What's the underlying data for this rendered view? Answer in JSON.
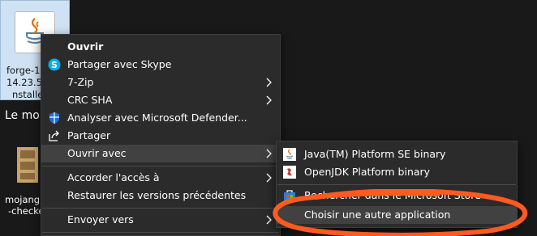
{
  "desktop": {
    "selected_icon_label": [
      "forge-1",
      "14.23.5.",
      "nstalle"
    ],
    "section_label": "Le mo",
    "mojang_label": [
      "mojang",
      "-checke"
    ]
  },
  "context_menu": {
    "items": [
      {
        "label": "Ouvrir",
        "icon": "none",
        "bold": true
      },
      {
        "label": "Partager avec Skype",
        "icon": "skype-icon"
      },
      {
        "label": "7-Zip",
        "submenu": true
      },
      {
        "label": "CRC SHA",
        "submenu": true
      },
      {
        "label": "Analyser avec Microsoft Defender...",
        "icon": "defender-shield-icon"
      },
      {
        "label": "Partager",
        "icon": "share-icon"
      },
      {
        "label": "Ouvrir avec",
        "submenu": true,
        "highlighted": true
      },
      {
        "label": "Accorder l'accès à",
        "submenu": true
      },
      {
        "label": "Restaurer les versions précédentes"
      },
      {
        "label": "Envoyer vers",
        "submenu": true
      }
    ]
  },
  "submenu": {
    "items": [
      {
        "label": "Java(TM) Platform SE binary",
        "icon": "java-icon"
      },
      {
        "label": "OpenJDK Platform binary",
        "icon": "openjdk-icon"
      },
      {
        "label": "Rechercher dans le Microsoft Store",
        "icon": "store-icon"
      },
      {
        "label": "Choisir une autre application",
        "highlighted": true
      }
    ]
  },
  "colors": {
    "menu_bg": "#2b2b2b",
    "highlight": "#414141",
    "annotation": "#ff5a1f",
    "skype": "#00aff0",
    "defender": "#1a6fd6"
  }
}
